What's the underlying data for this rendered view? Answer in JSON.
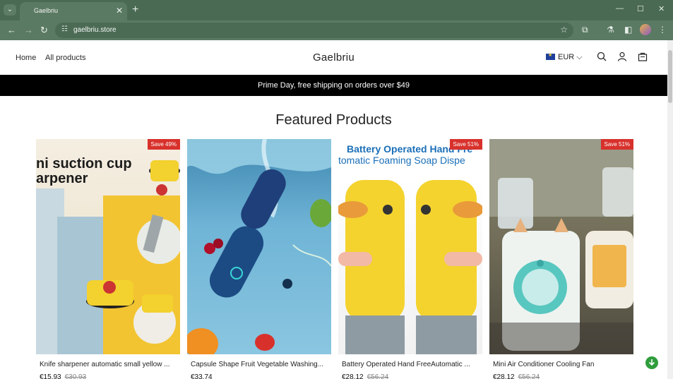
{
  "browser": {
    "tab_title": "Gaelbriu",
    "url": "gaelbriu.store"
  },
  "header": {
    "nav": [
      "Home",
      "All products"
    ],
    "brand": "Gaelbriu",
    "currency": "EUR"
  },
  "announcement": "Prime Day, free shipping on orders over $49",
  "featured_title": "Featured Products",
  "products": [
    {
      "badge": "Save 49%",
      "image_caption": [
        "ni suction cup",
        "arpener"
      ],
      "name": "Knife sharpener automatic small yellow ...",
      "price": "€15,93",
      "compare_price": "€30,93"
    },
    {
      "badge": "",
      "name": "Capsule Shape Fruit Vegetable Washing...",
      "price": "€33,74",
      "compare_price": ""
    },
    {
      "badge": "Save 51%",
      "image_caption": [
        "Battery Operated Hand Fre",
        "tomatic Foaming Soap Dispe"
      ],
      "name": "Battery Operated Hand FreeAutomatic ...",
      "price": "€28,12",
      "compare_price": "€56,24"
    },
    {
      "badge": "Save 51%",
      "name": "Mini Air Conditioner Cooling Fan",
      "price": "€28,12",
      "compare_price": "€56,24"
    }
  ],
  "colors": {
    "badge": "#d8312c",
    "announcement_bg": "#000000",
    "browser_frame": "#4a6a53"
  }
}
